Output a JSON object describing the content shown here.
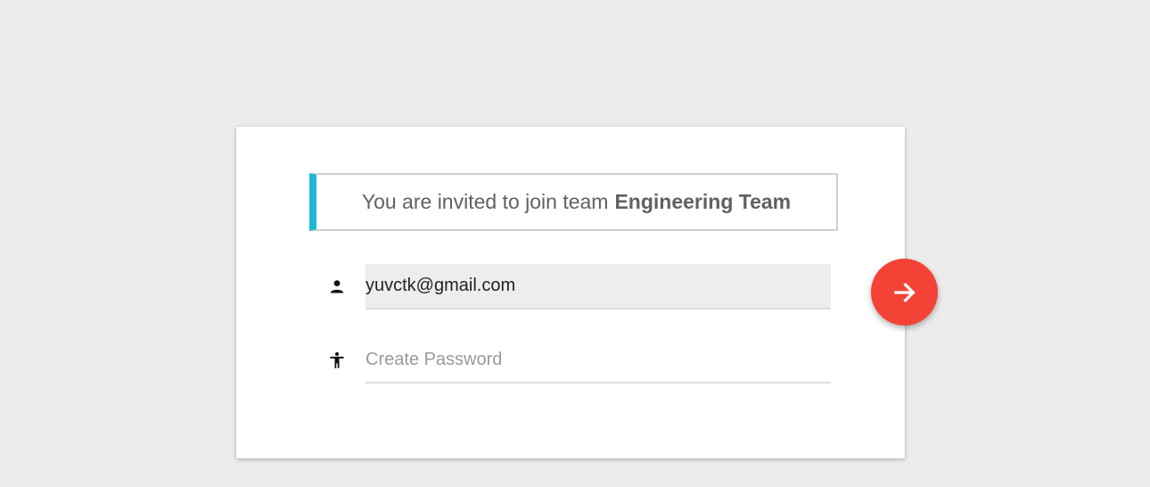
{
  "invite": {
    "prefix": "You are invited to join team",
    "team_name": "Engineering Team",
    "accent_color": "#1cb8d6"
  },
  "form": {
    "email": {
      "value": "yuvctk@gmail.com",
      "icon": "person-icon"
    },
    "password": {
      "value": "",
      "placeholder": "Create Password",
      "icon": "accessibility-icon"
    }
  },
  "submit": {
    "icon": "arrow-forward-icon",
    "color": "#f44336"
  }
}
